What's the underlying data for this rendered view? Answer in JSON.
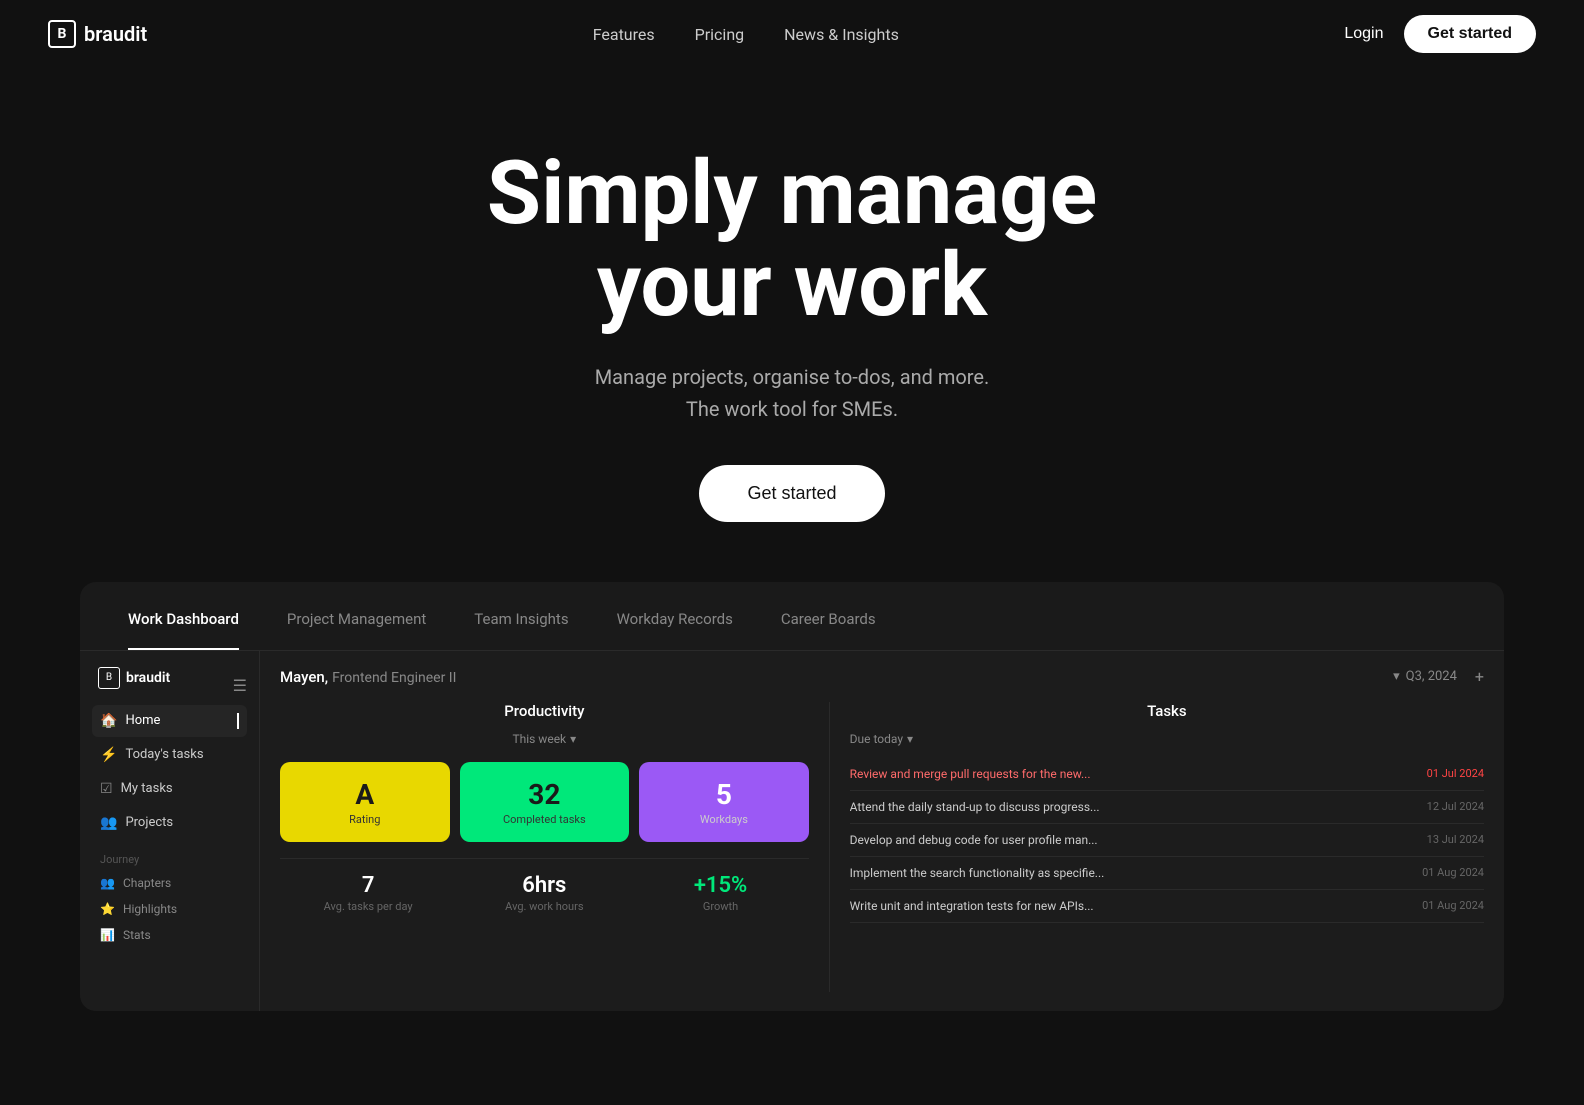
{
  "navbar": {
    "logo_icon": "B",
    "logo_text": "braudit",
    "links": [
      {
        "label": "Features",
        "id": "features"
      },
      {
        "label": "Pricing",
        "id": "pricing"
      },
      {
        "label": "News & Insights",
        "id": "news"
      }
    ],
    "login_label": "Login",
    "get_started_label": "Get started"
  },
  "hero": {
    "title_line1": "Simply manage",
    "title_line2": "your work",
    "subtitle_line1": "Manage projects, organise to-dos, and more.",
    "subtitle_line2": "The work tool for SMEs.",
    "cta_label": "Get started"
  },
  "tabs": [
    {
      "label": "Work Dashboard",
      "id": "work-dashboard",
      "active": true
    },
    {
      "label": "Project Management",
      "id": "project-management",
      "active": false
    },
    {
      "label": "Team Insights",
      "id": "team-insights",
      "active": false
    },
    {
      "label": "Workday Records",
      "id": "workday-records",
      "active": false
    },
    {
      "label": "Career Boards",
      "id": "career-boards",
      "active": false
    }
  ],
  "dashboard": {
    "sidebar": {
      "logo_icon": "B",
      "logo_text": "braudit",
      "nav_items": [
        {
          "label": "Home",
          "icon": "🏠",
          "active": true
        },
        {
          "label": "Today's tasks",
          "icon": "⚡",
          "active": false
        },
        {
          "label": "My tasks",
          "icon": "☑",
          "active": false
        },
        {
          "label": "Projects",
          "icon": "👥",
          "active": false
        }
      ],
      "section_label": "Journey",
      "sub_items": [
        {
          "label": "Chapters",
          "icon": "👥"
        },
        {
          "label": "Highlights",
          "icon": "⭐"
        },
        {
          "label": "Stats",
          "icon": "📊"
        }
      ]
    },
    "header": {
      "user_name": "Mayen,",
      "user_role": "Frontend Engineer II",
      "quarter": "Q3, 2024"
    },
    "productivity": {
      "title": "Productivity",
      "period": "This week",
      "stat_cards": [
        {
          "value": "A",
          "label": "Rating",
          "color": "yellow"
        },
        {
          "value": "32",
          "label": "Completed tasks",
          "color": "green"
        },
        {
          "value": "5",
          "label": "Workdays",
          "color": "purple"
        }
      ],
      "bottom_stats": [
        {
          "value": "7",
          "label": "Avg. tasks per day",
          "color": "white"
        },
        {
          "value": "6hrs",
          "label": "Avg. work hours",
          "color": "white"
        },
        {
          "value": "+15%",
          "label": "Growth",
          "color": "green"
        }
      ]
    },
    "tasks": {
      "title": "Tasks",
      "filter": "Due today",
      "items": [
        {
          "text": "Review and merge pull requests for the new...",
          "date": "01 Jul 2024",
          "overdue": true
        },
        {
          "text": "Attend the daily stand-up to discuss progress...",
          "date": "12 Jul 2024",
          "overdue": false
        },
        {
          "text": "Develop and debug code for user profile man...",
          "date": "13 Jul 2024",
          "overdue": false
        },
        {
          "text": "Implement the search functionality as specifie...",
          "date": "01 Aug 2024",
          "overdue": false
        },
        {
          "text": "Write unit and integration tests for new APIs...",
          "date": "01 Aug 2024",
          "overdue": false
        }
      ]
    }
  }
}
